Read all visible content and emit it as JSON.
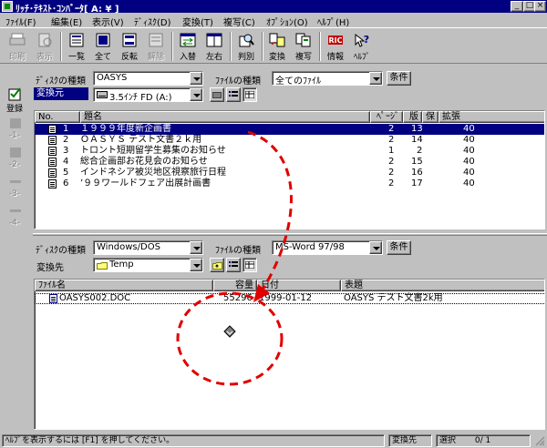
{
  "window": {
    "title": "ﾘｯﾁ･ﾃｷｽﾄ･ｺﾝﾊﾞｰﾀ[ A: ¥ ]",
    "min_label": "_",
    "max_label": "□",
    "close_label": "×"
  },
  "menu": [
    "ﾌｧｲﾙ(F)",
    "編集(E)",
    "表示(V)",
    "ﾃﾞｨｽｸ(D)",
    "変換(T)",
    "複写(C)",
    "ｵﾌﾟｼｮﾝ(O)",
    "ﾍﾙﾌﾟ(H)"
  ],
  "toolbar": [
    {
      "label": "印刷",
      "icon": "printer-icon",
      "enabled": false
    },
    {
      "label": "表示",
      "icon": "view-icon",
      "enabled": false
    },
    {
      "label": "一覧",
      "icon": "list-icon",
      "enabled": true
    },
    {
      "label": "全て",
      "icon": "select-all-icon",
      "enabled": true
    },
    {
      "label": "反転",
      "icon": "invert-icon",
      "enabled": true
    },
    {
      "label": "解除",
      "icon": "deselect-icon",
      "enabled": false
    },
    {
      "label": "入替",
      "icon": "swap-icon",
      "enabled": true
    },
    {
      "label": "左右",
      "icon": "split-icon",
      "enabled": true
    },
    {
      "label": "判別",
      "icon": "detect-icon",
      "enabled": true
    },
    {
      "label": "変換",
      "icon": "convert-icon",
      "enabled": true
    },
    {
      "label": "複写",
      "icon": "copy-icon",
      "enabled": true
    },
    {
      "label": "情報",
      "icon": "info-icon",
      "enabled": true
    },
    {
      "label": "ﾍﾙﾌﾟ",
      "icon": "help-icon",
      "enabled": true
    }
  ],
  "source": {
    "disk_type_label": "ﾃﾞｨｽｸの種類",
    "disk_type": "OASYS",
    "file_type_label": "ﾌｧｲﾙの種類",
    "file_type": "全てのﾌｧｲﾙ",
    "condition_label": "条件",
    "location_label": "変換元",
    "location": "3.5ｲﾝﾁ FD (A:)",
    "columns": [
      "No.",
      "題名",
      "ﾍﾟｰｼﾞ",
      "版",
      "保",
      "拡張"
    ],
    "files": [
      {
        "no": "1",
        "title": "１９９９年度新企画書",
        "pages": "2",
        "ver": "13",
        "prot": "",
        "ext": "40",
        "selected": true
      },
      {
        "no": "2",
        "title": "ＯＡＳＹＳ テスト文書２ｋ用",
        "pages": "2",
        "ver": "14",
        "prot": "",
        "ext": "40",
        "selected": false
      },
      {
        "no": "3",
        "title": "トロント短期留学生募集のお知らせ",
        "pages": "1",
        "ver": "2",
        "prot": "",
        "ext": "40",
        "selected": false
      },
      {
        "no": "4",
        "title": "総合企画部お花見会のお知らせ",
        "pages": "2",
        "ver": "15",
        "prot": "",
        "ext": "40",
        "selected": false
      },
      {
        "no": "5",
        "title": "インドネシア被災地区視察旅行日程",
        "pages": "2",
        "ver": "16",
        "prot": "",
        "ext": "40",
        "selected": false
      },
      {
        "no": "6",
        "title": "’９９ワールドフェア出展計画書",
        "pages": "2",
        "ver": "17",
        "prot": "",
        "ext": "40",
        "selected": false
      }
    ]
  },
  "sidebar": {
    "register_label": "登録",
    "slots": [
      "-1-",
      "-2-",
      "-3-",
      "-4-"
    ]
  },
  "dest": {
    "disk_type_label": "ﾃﾞｨｽｸの種類",
    "disk_type": "Windows/DOS",
    "file_type_label": "ﾌｧｲﾙの種類",
    "file_type": "MS-Word 97/98",
    "condition_label": "条件",
    "location_label": "変換先",
    "location": "Temp",
    "columns": [
      "ﾌｧｲﾙ名",
      "容量",
      "日付",
      "表題"
    ],
    "files": [
      {
        "name": "OASYS002.DOC",
        "size": "55296",
        "date": "1999-01-12",
        "title": "OASYS テスト文書2k用"
      }
    ]
  },
  "status": {
    "help": "ﾍﾙﾌﾟを表示するには [F1] を押してください。",
    "mode": "変換先",
    "selection_label": "選択",
    "selection": "0/  1"
  },
  "colors": {
    "arrow": "#e00000",
    "selection": "#000080",
    "titlebar": "#000080"
  }
}
